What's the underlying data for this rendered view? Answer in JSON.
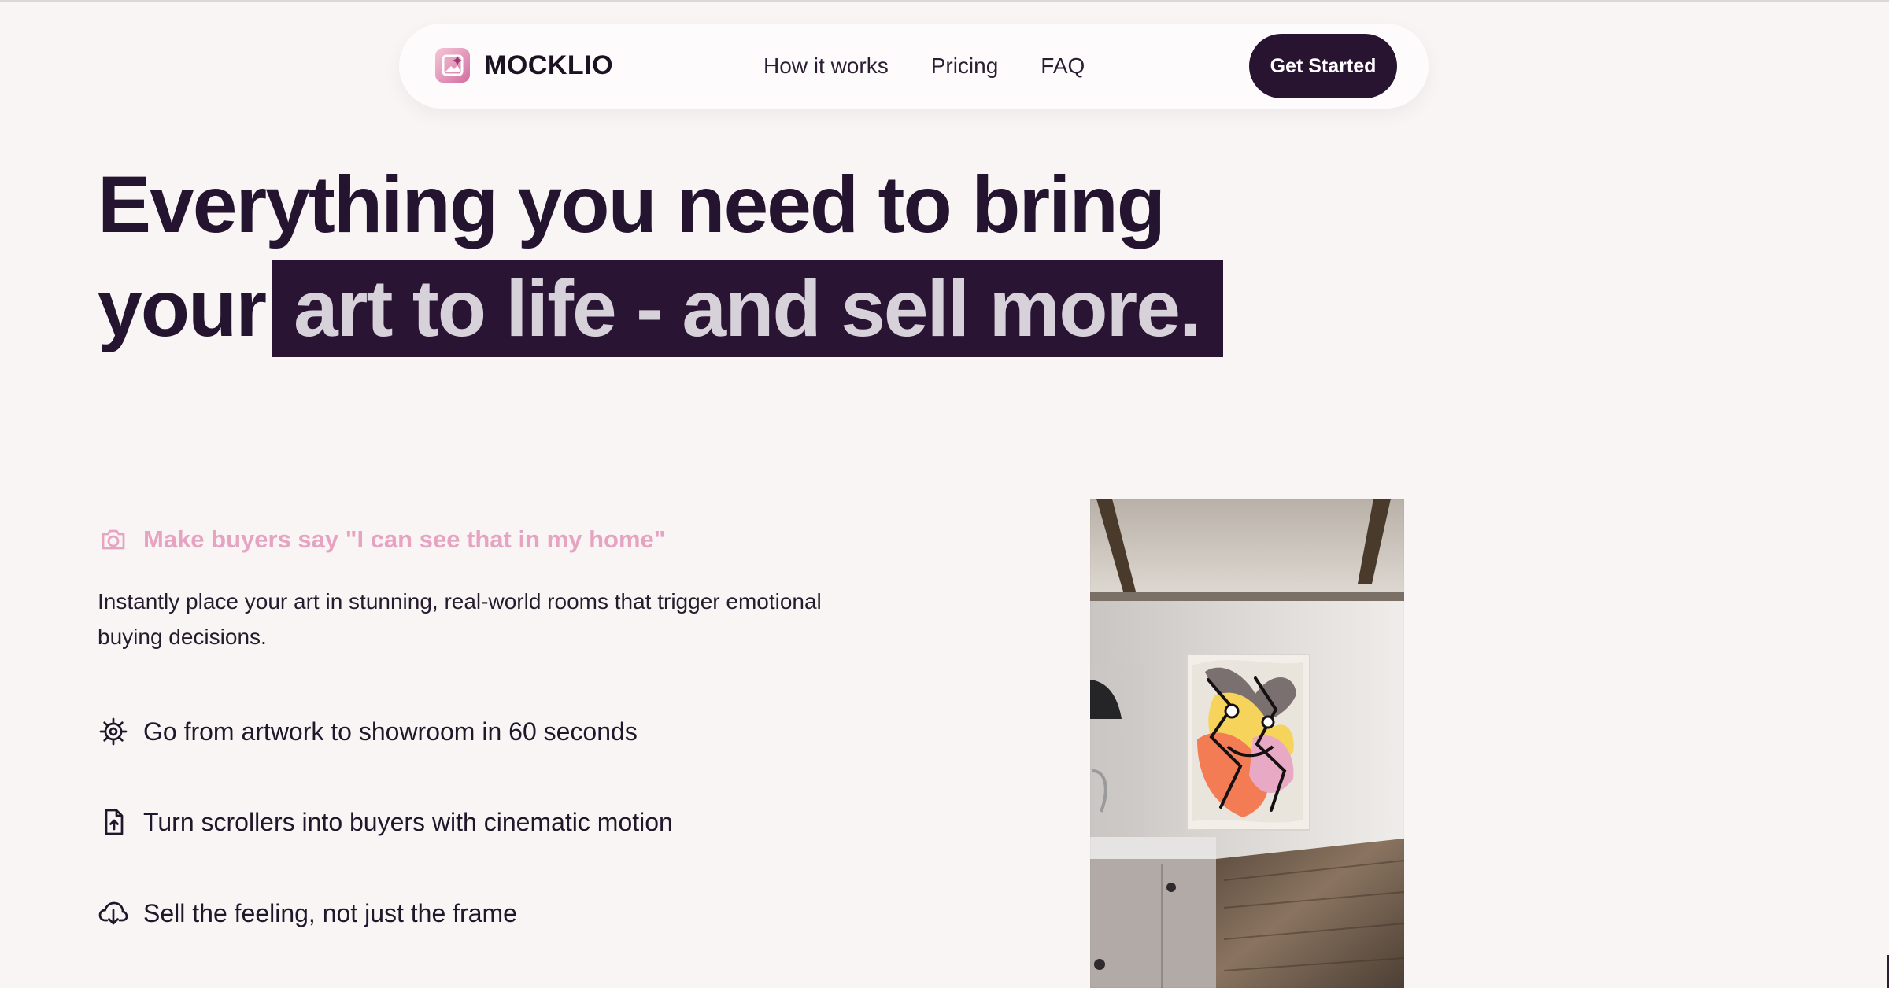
{
  "brand": {
    "name": "MOCKLIO",
    "logo_icon": "image-sparkle-icon",
    "accent_color": "#e6a4c2",
    "dark_color": "#281431"
  },
  "nav": {
    "links": [
      "How it works",
      "Pricing",
      "FAQ"
    ],
    "cta": "Get Started"
  },
  "hero": {
    "line1": "Everything you need to bring",
    "line2_prefix": "your",
    "line2_highlight": "art to life - and sell more."
  },
  "feature": {
    "icon": "camera-icon",
    "heading": "Make buyers say \"I can see that in my home\"",
    "description": "Instantly place your art in stunning, real-world rooms that trigger emotional buying decisions."
  },
  "bullets": [
    {
      "icon": "gear-icon",
      "text": "Go from artwork to showroom in 60 seconds"
    },
    {
      "icon": "file-upload-icon",
      "text": "Turn scrollers into buyers with cinematic motion"
    },
    {
      "icon": "cloud-download-icon",
      "text": "Sell the feeling, not just the frame"
    }
  ],
  "preview": {
    "image": "room-mockup-image"
  }
}
